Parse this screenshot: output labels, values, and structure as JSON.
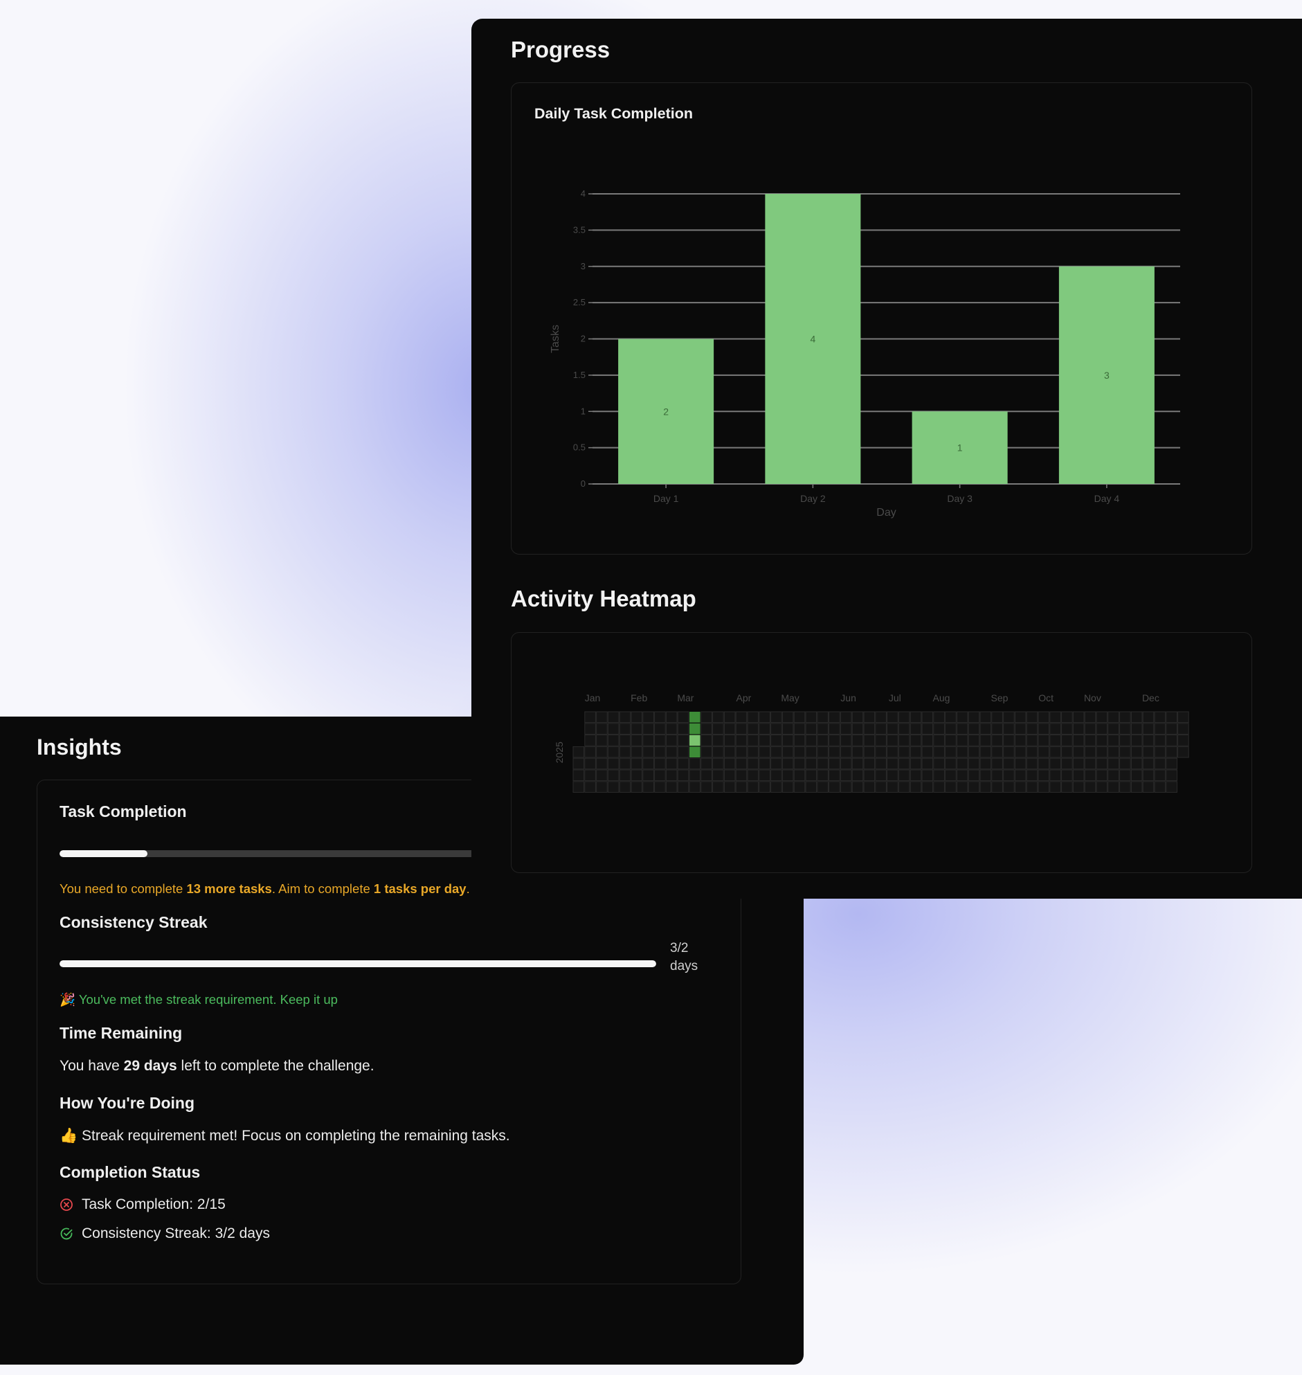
{
  "insights": {
    "title": "Insights",
    "task_completion": {
      "heading": "Task Completion",
      "progress": 0.1333,
      "note_parts": [
        "You need to complete ",
        "13 more tasks",
        ". Aim to complete ",
        "1 tasks per day",
        "."
      ]
    },
    "streak": {
      "heading": "Consistency Streak",
      "progress": 1.0,
      "value_label_1": "3/2",
      "value_label_2": "days",
      "message_emoji": "🎉",
      "message": "You've met the streak requirement. Keep it up"
    },
    "time_remaining": {
      "heading": "Time Remaining",
      "text_parts": [
        "You have ",
        "29 days",
        " left to complete the challenge."
      ]
    },
    "how_doing": {
      "heading": "How You're Doing",
      "emoji": "👍",
      "message": "Streak requirement met! Focus on completing the remaining tasks."
    },
    "completion_status": {
      "heading": "Completion Status",
      "items": [
        {
          "label": "Task Completion: 2/15",
          "status": "fail",
          "icon": "x-circle-icon",
          "color": "#e5484d"
        },
        {
          "label": "Consistency Streak: 3/2 days",
          "status": "pass",
          "icon": "check-circle-icon",
          "color": "#46b95a"
        }
      ]
    }
  },
  "progress": {
    "title": "Progress",
    "chart_title": "Daily Task Completion",
    "heatmap_title": "Activity Heatmap"
  },
  "colors": {
    "bar": "#80c97e",
    "panel_bg": "#0a0a0a",
    "amber": "#e9a828",
    "green": "#4cbc5e",
    "heat_levels": [
      "#151515",
      "#1f4d20",
      "#3d8c37",
      "#7bc36f"
    ]
  },
  "chart_data": [
    {
      "type": "bar",
      "title": "Daily Task Completion",
      "categories": [
        "Day 1",
        "Day 2",
        "Day 3",
        "Day 4"
      ],
      "values": [
        2,
        4,
        1,
        3
      ],
      "data_labels": [
        "2",
        "4",
        "1",
        "3"
      ],
      "xlabel": "Day",
      "ylabel": "Tasks",
      "ylim": [
        0,
        4
      ],
      "yticks": [
        "0",
        "0.5",
        "1",
        "1.5",
        "2",
        "2.5",
        "3",
        "3.5",
        "4"
      ],
      "grid": true
    },
    {
      "type": "heatmap",
      "title": "Activity Heatmap",
      "year_label": "2025",
      "months": [
        "Jan",
        "Feb",
        "Mar",
        "Apr",
        "May",
        "Jun",
        "Jul",
        "Aug",
        "Sep",
        "Oct",
        "Nov",
        "Dec"
      ],
      "active_days": [
        {
          "date": "2025-03-09",
          "level": 2
        },
        {
          "date": "2025-03-10",
          "level": 2
        },
        {
          "date": "2025-03-11",
          "level": 3
        },
        {
          "date": "2025-03-12",
          "level": 2
        }
      ]
    }
  ]
}
